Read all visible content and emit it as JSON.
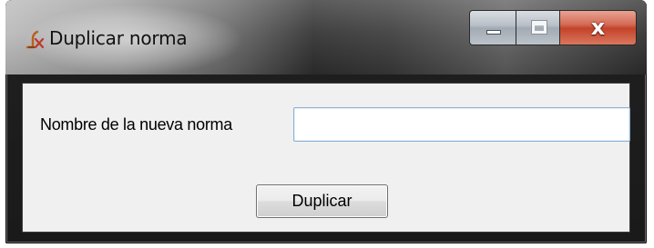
{
  "window": {
    "title": "Duplicar norma",
    "app_icon": "sigma-formula-icon",
    "caption_buttons": {
      "minimize_icon": "minimize-icon",
      "maximize_icon": "maximize-icon",
      "close_glyph": "x"
    }
  },
  "form": {
    "field_label": "Nombre de la nueva norma",
    "field_value": "",
    "button_label": "Duplicar"
  },
  "colors": {
    "close_button": "#c4432a",
    "input_border": "#8fb1d3",
    "client_background": "#f0f0f0"
  }
}
